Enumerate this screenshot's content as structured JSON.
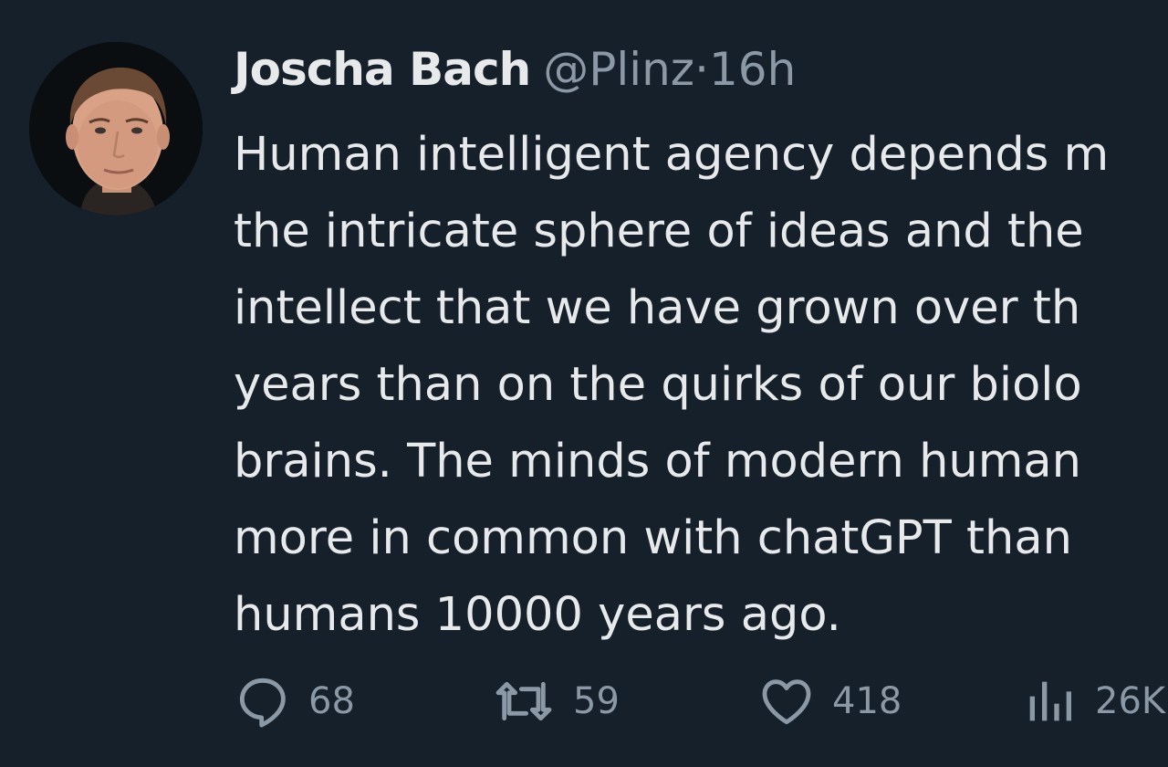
{
  "tweet": {
    "author": {
      "display_name": "Joscha Bach",
      "handle": "@Plinz",
      "avatar": "profile-photo"
    },
    "separator": "·",
    "time": "16h",
    "text_lines": [
      "Human intelligent agency depends m",
      "the intricate sphere of ideas and the",
      "intellect that we have grown over th",
      "years than on the quirks of our biolo",
      "brains. The minds of modern human",
      "more in common with chatGPT than",
      "humans 10000 years ago."
    ]
  },
  "actions": {
    "reply": {
      "icon": "reply-icon",
      "count": "68"
    },
    "retweet": {
      "icon": "retweet-icon",
      "count": "59"
    },
    "like": {
      "icon": "heart-icon",
      "count": "418"
    },
    "views": {
      "icon": "views-icon",
      "count": "26K"
    }
  },
  "colors": {
    "background": "#15202b",
    "primary_text": "#e7e9ea",
    "secondary_text": "#8b98a5"
  }
}
